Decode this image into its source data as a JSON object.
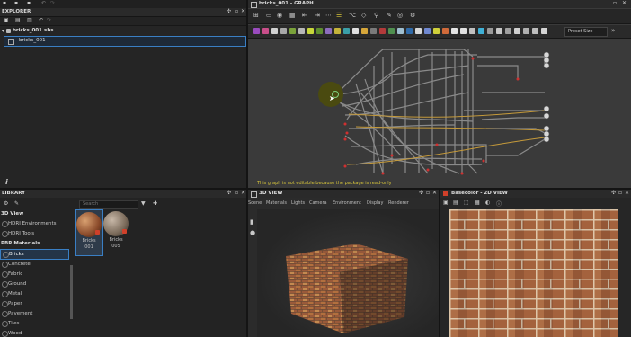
{
  "explorer": {
    "title": "EXPLORER",
    "package": "bricks_001.sbs",
    "graph": "bricks_001"
  },
  "graph_panel": {
    "title": "bricks_001 - GRAPH",
    "preset_label": "Preset Size",
    "warning": "This graph is not editable because the package is read-only"
  },
  "library": {
    "title": "LIBRARY",
    "search_placeholder": "Search",
    "categories": [
      {
        "label": "3D View",
        "type": "header"
      },
      {
        "label": "HDRI Environments",
        "type": "item"
      },
      {
        "label": "HDRI Tools",
        "type": "item"
      },
      {
        "label": "PBR Materials",
        "type": "header"
      },
      {
        "label": "Bricks",
        "type": "selected"
      },
      {
        "label": "Concrete",
        "type": "item"
      },
      {
        "label": "Fabric",
        "type": "item"
      },
      {
        "label": "Ground",
        "type": "item"
      },
      {
        "label": "Metal",
        "type": "item"
      },
      {
        "label": "Paper",
        "type": "item"
      },
      {
        "label": "Pavement",
        "type": "item"
      },
      {
        "label": "Tiles",
        "type": "item"
      },
      {
        "label": "Wood",
        "type": "item"
      }
    ],
    "materials": [
      {
        "name": "Bricks",
        "number": "001"
      },
      {
        "name": "Bricks",
        "number": "005"
      }
    ]
  },
  "view3d": {
    "title": "3D VIEW",
    "menu": [
      "Scene",
      "Materials",
      "Lights",
      "Camera",
      "Environment",
      "Display",
      "Renderer"
    ]
  },
  "view2d": {
    "title": "Basecolor - 2D VIEW"
  },
  "colors": {
    "accent": "#3a7fc4",
    "selection": "#5a8fd0",
    "warning_text": "#d6c43a",
    "node_red": "#d03030"
  }
}
